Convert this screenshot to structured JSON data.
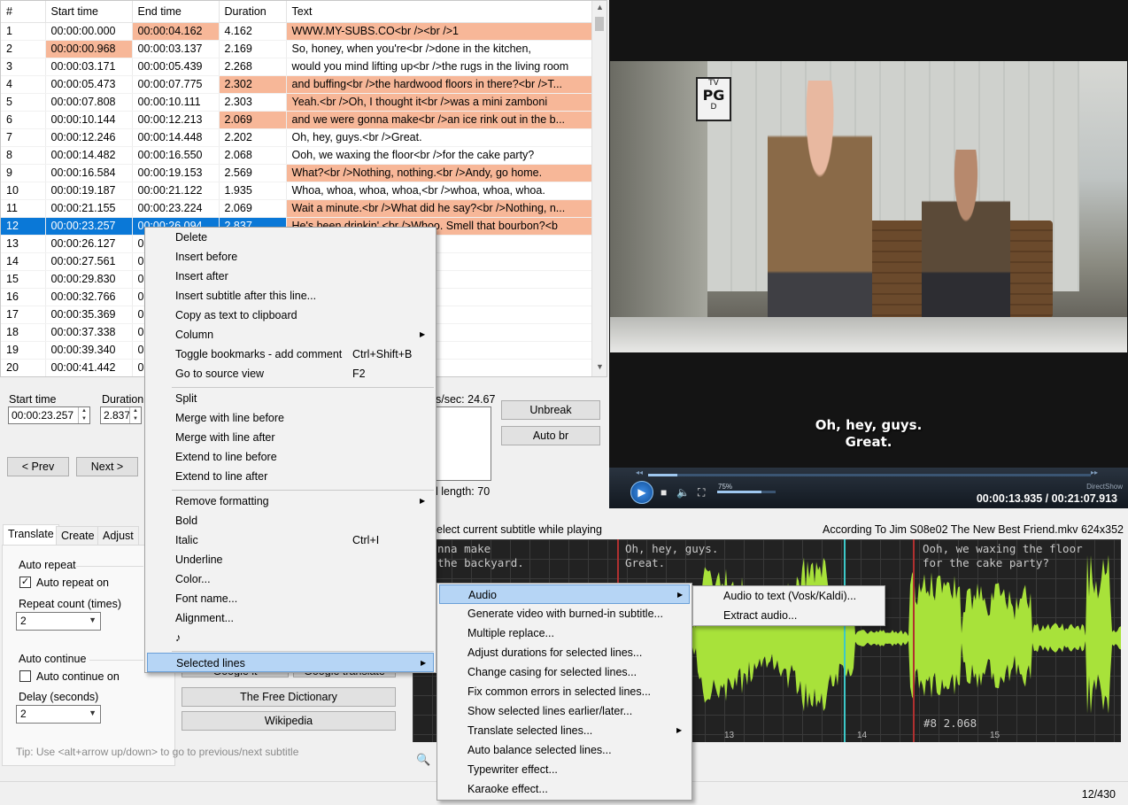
{
  "grid": {
    "headers": [
      "#",
      "Start time",
      "End time",
      "Duration",
      "Text"
    ],
    "rows": [
      {
        "n": "1",
        "start": "00:00:00.000",
        "end": "00:00:04.162",
        "dur": "4.162",
        "text": "WWW.MY-SUBS.CO<br /><br />1"
      },
      {
        "n": "2",
        "start": "00:00:00.968",
        "end": "00:00:03.137",
        "dur": "2.169",
        "text": "So, honey, when you're<br />done in the kitchen,"
      },
      {
        "n": "3",
        "start": "00:00:03.171",
        "end": "00:00:05.439",
        "dur": "2.268",
        "text": "would you mind lifting up<br />the rugs in the living room"
      },
      {
        "n": "4",
        "start": "00:00:05.473",
        "end": "00:00:07.775",
        "dur": "2.302",
        "text": "and buffing<br />the hardwood floors in there?<br />T..."
      },
      {
        "n": "5",
        "start": "00:00:07.808",
        "end": "00:00:10.111",
        "dur": "2.303",
        "text": "Yeah.<br />Oh, I thought it<br />was a mini zamboni"
      },
      {
        "n": "6",
        "start": "00:00:10.144",
        "end": "00:00:12.213",
        "dur": "2.069",
        "text": "and we were gonna make<br />an ice rink out in the b..."
      },
      {
        "n": "7",
        "start": "00:00:12.246",
        "end": "00:00:14.448",
        "dur": "2.202",
        "text": "Oh, hey, guys.<br />Great."
      },
      {
        "n": "8",
        "start": "00:00:14.482",
        "end": "00:00:16.550",
        "dur": "2.068",
        "text": "Ooh, we waxing the floor<br />for the cake party?"
      },
      {
        "n": "9",
        "start": "00:00:16.584",
        "end": "00:00:19.153",
        "dur": "2.569",
        "text": "What?<br />Nothing, nothing.<br />Andy, go home."
      },
      {
        "n": "10",
        "start": "00:00:19.187",
        "end": "00:00:21.122",
        "dur": "1.935",
        "text": "Whoa, whoa, whoa, whoa,<br />whoa, whoa, whoa."
      },
      {
        "n": "11",
        "start": "00:00:21.155",
        "end": "00:00:23.224",
        "dur": "2.069",
        "text": "Wait a minute.<br />What did he say?<br />Nothing, n..."
      },
      {
        "n": "12",
        "start": "00:00:23.257",
        "end": "00:00:26.094",
        "dur": "2.837",
        "text": "He's been drinkin'.<br />Whoo. Smell that bourbon?<b"
      },
      {
        "n": "13",
        "start": "00:00:26.127",
        "end": "0",
        "dur": "",
        "text": "h of ya!"
      },
      {
        "n": "14",
        "start": "00:00:27.561",
        "end": "0",
        "dur": "",
        "text": "p\" word."
      },
      {
        "n": "15",
        "start": "00:00:29.830",
        "end": "0",
        "dur": "",
        "text": "r />t-e-l-l space h-i-m."
      },
      {
        "n": "16",
        "start": "00:00:32.766",
        "end": "0",
        "dur": "",
        "text": "n-c-e."
      },
      {
        "n": "17",
        "start": "00:00:35.369",
        "end": "0",
        "dur": "",
        "text": "re what you spell,"
      },
      {
        "n": "18",
        "start": "00:00:37.338",
        "end": "0",
        "dur": "",
        "text": ""
      },
      {
        "n": "19",
        "start": "00:00:39.340",
        "end": "0",
        "dur": "",
        "text": "ve me a chance to explain."
      },
      {
        "n": "20",
        "start": "00:00:41.442",
        "end": "0",
        "dur": "",
        "text": "g, Cheryl?"
      }
    ]
  },
  "edit": {
    "start_label": "Start time",
    "start_value": "00:00:23.257",
    "duration_label": "Duration",
    "duration_value": "2.837",
    "prev": "< Prev",
    "next": "Next >",
    "cps": "s/sec: 24.67",
    "total_length": "l length: 70",
    "unbreak": "Unbreak",
    "auto_br": "Auto br"
  },
  "tabs": [
    "Translate",
    "Create",
    "Adjust"
  ],
  "translate": {
    "auto_repeat_title": "Auto repeat",
    "auto_repeat_on": "Auto repeat on",
    "repeat_count_label": "Repeat count (times)",
    "repeat_count": "2",
    "auto_continue_title": "Auto continue",
    "auto_continue_on": "Auto continue on",
    "delay_label": "Delay (seconds)",
    "delay": "2",
    "google_it": "Google it",
    "google_translate": "Google translate",
    "free_dictionary": "The Free Dictionary",
    "wikipedia": "Wikipedia",
    "tip": "Tip: Use <alt+arrow up/down> to go to previous/next subtitle"
  },
  "video": {
    "rating_top": "TV",
    "rating_mid": "PG",
    "rating_bot": "D",
    "caption_line1": "Oh, hey, guys.",
    "caption_line2": "Great.",
    "volume": "75%",
    "renderer": "DirectShow",
    "timecode": "00:00:13.935 / 00:21:07.913"
  },
  "waveform": {
    "header_left": "elect current subtitle while playing",
    "header_right": "According To Jim S08e02 The New Best Friend.mkv 624x352",
    "seg1_l1": "nna make",
    "seg1_l2": "the backyard.",
    "seg2_l1": "Oh, hey, guys.",
    "seg2_l2": "Great.",
    "seg3_l1": "Ooh, we waxing the floor",
    "seg3_l2": "for the cake party?",
    "seg_info": "#8  2.068",
    "sec13": "13",
    "sec14": "14",
    "sec15": "15",
    "wave_color": "#a8e23a"
  },
  "status": {
    "count": "12/430"
  },
  "context_menu": {
    "items": [
      {
        "label": "Delete",
        "shortcut": ""
      },
      {
        "label": "Insert before",
        "shortcut": ""
      },
      {
        "label": "Insert after",
        "shortcut": ""
      },
      {
        "label": "Insert subtitle after this line...",
        "shortcut": ""
      },
      {
        "label": "Copy as text to clipboard",
        "shortcut": ""
      },
      {
        "label": "Column",
        "shortcut": ""
      },
      {
        "label": "Toggle bookmarks - add comment",
        "shortcut": "Ctrl+Shift+B"
      },
      {
        "label": "Go to source view",
        "shortcut": "F2"
      },
      {
        "label": "Split",
        "shortcut": ""
      },
      {
        "label": "Merge with line before",
        "shortcut": ""
      },
      {
        "label": "Merge with line after",
        "shortcut": ""
      },
      {
        "label": "Extend to line before",
        "shortcut": ""
      },
      {
        "label": "Extend to line after",
        "shortcut": ""
      },
      {
        "label": "Remove formatting",
        "shortcut": ""
      },
      {
        "label": "Bold",
        "shortcut": ""
      },
      {
        "label": "Italic",
        "shortcut": "Ctrl+I"
      },
      {
        "label": "Underline",
        "shortcut": ""
      },
      {
        "label": "Color...",
        "shortcut": ""
      },
      {
        "label": "Font name...",
        "shortcut": ""
      },
      {
        "label": "Alignment...",
        "shortcut": ""
      },
      {
        "label": "♪",
        "shortcut": ""
      },
      {
        "label": "Selected lines",
        "shortcut": ""
      }
    ]
  },
  "selected_lines_menu": {
    "items": [
      "Audio",
      "Generate video with burned-in subtitle...",
      "Multiple replace...",
      "Adjust durations for selected lines...",
      "Change casing for selected lines...",
      "Fix common errors in selected lines...",
      "Show selected lines earlier/later...",
      "Translate selected lines...",
      "Auto balance selected lines...",
      "Typewriter effect...",
      "Karaoke effect..."
    ]
  },
  "audio_menu": {
    "items": [
      "Audio to text (Vosk/Kaldi)...",
      "Extract audio..."
    ]
  },
  "colors": {
    "selection": "#0a78d7",
    "highlight": "#f7b798",
    "menu_hover": "#b6d5f5"
  }
}
